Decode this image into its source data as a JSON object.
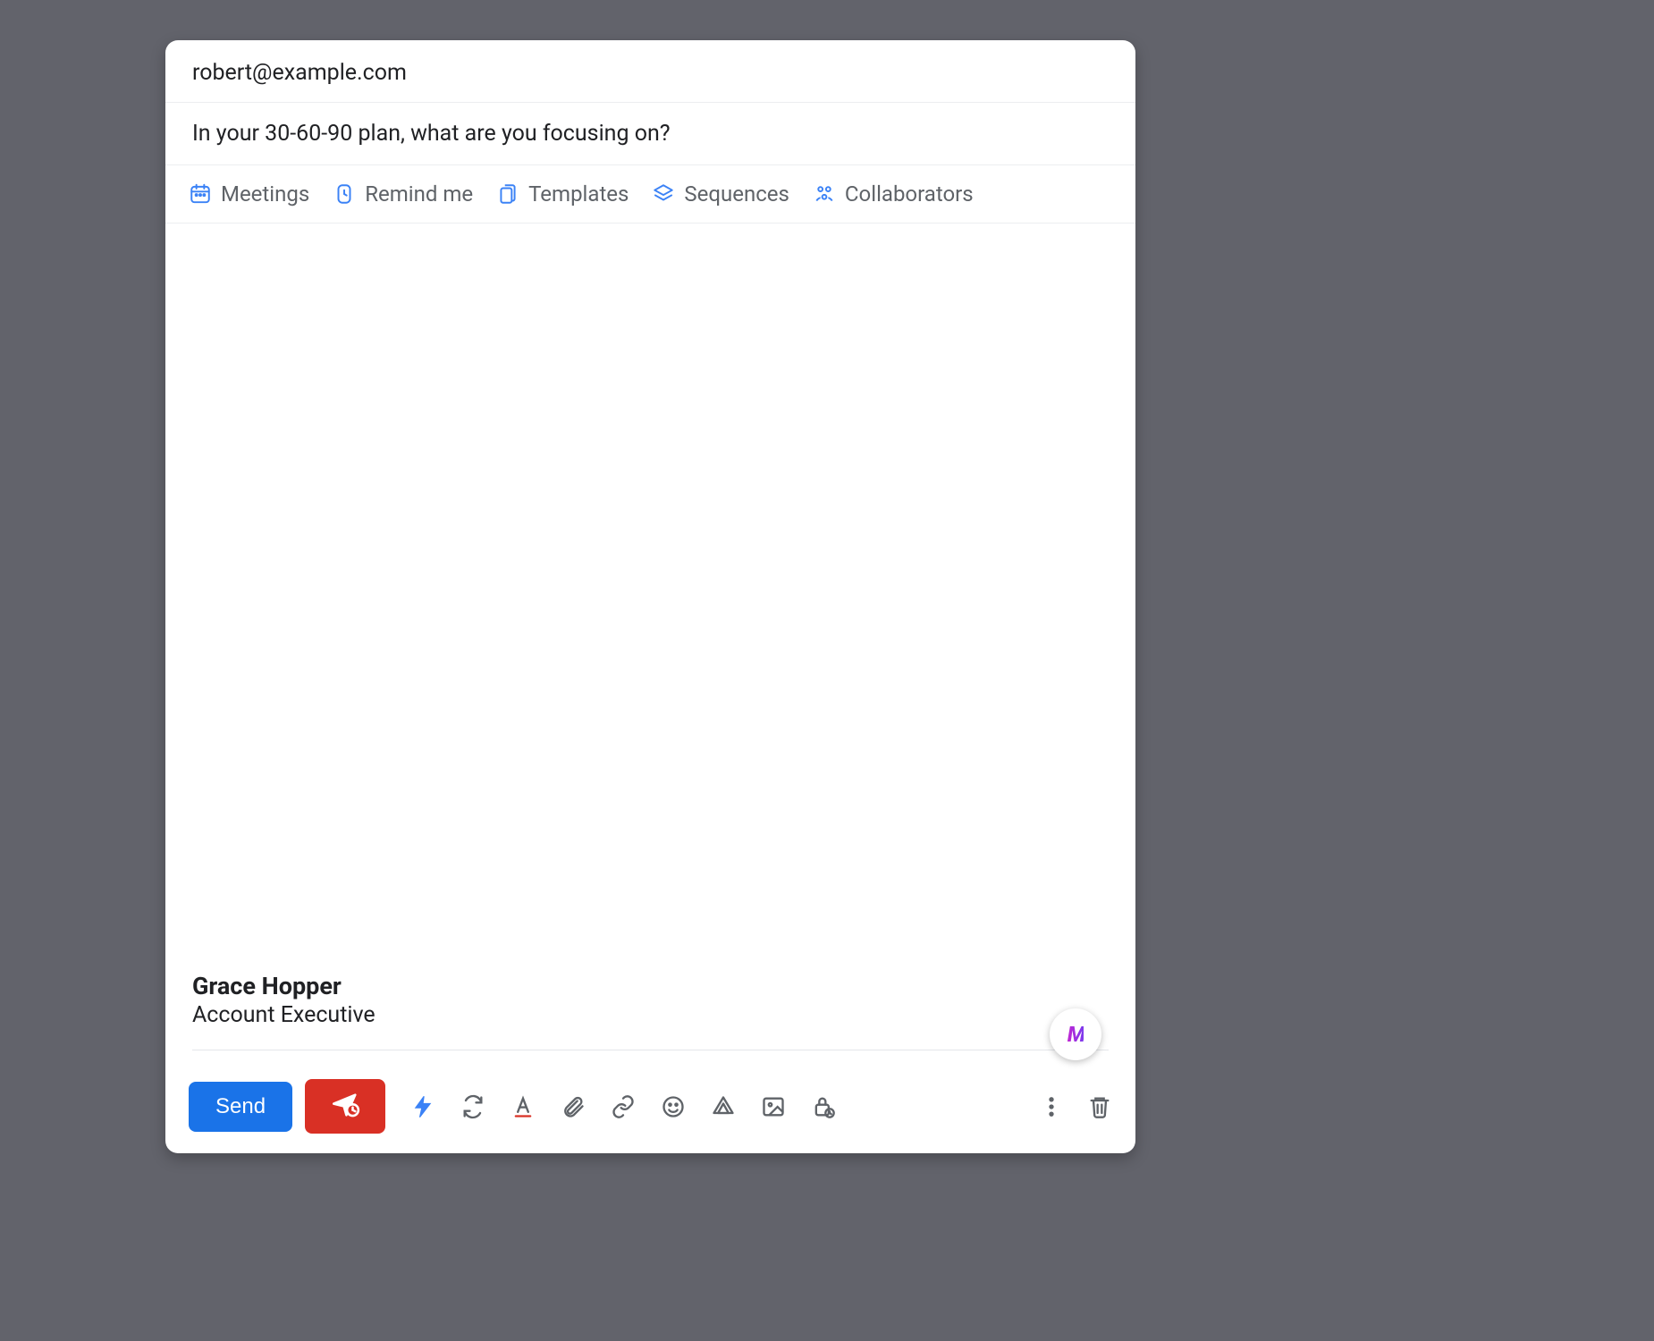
{
  "to": "robert@example.com",
  "subject": "In your 30-60-90 plan, what are you focusing on?",
  "strip": {
    "meetings": "Meetings",
    "remind": "Remind me",
    "templates": "Templates",
    "sequences": "Sequences",
    "collaborators": "Collaborators"
  },
  "signature": {
    "name": "Grace Hopper",
    "title": "Account Executive"
  },
  "send_label": "Send",
  "badge_initials": "M"
}
